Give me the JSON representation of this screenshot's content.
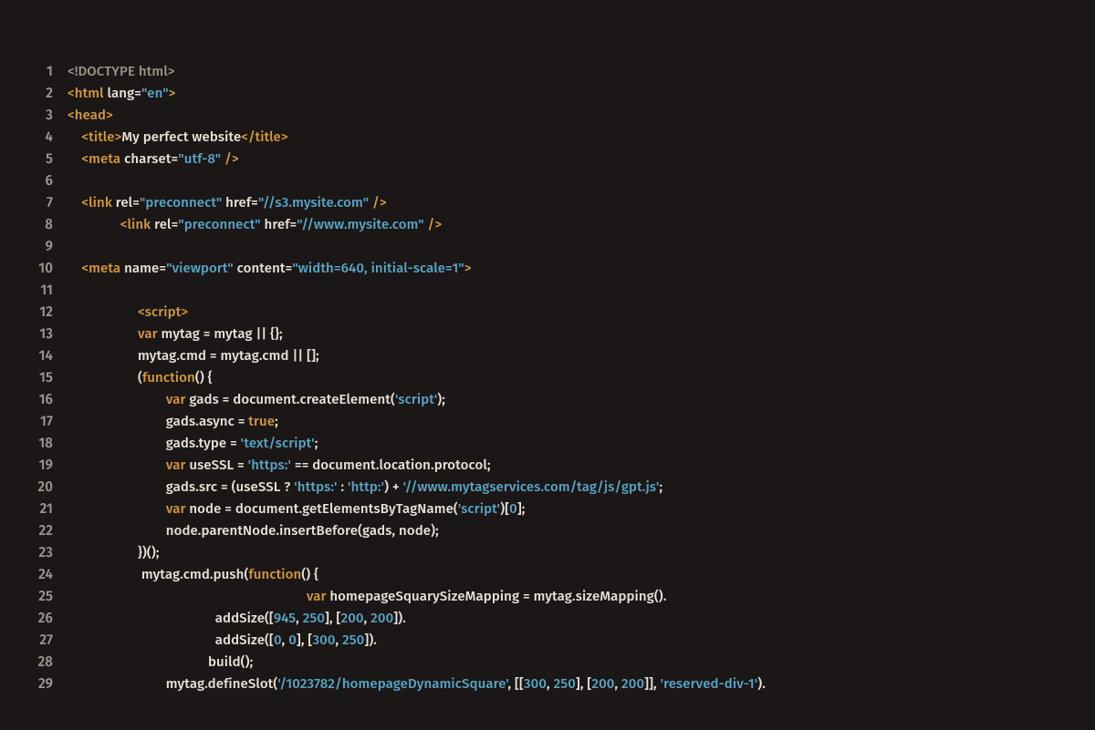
{
  "editor": {
    "theme": {
      "background": "#1b1717",
      "foreground": "#e9e4d8",
      "gutter": "#9a958b",
      "tag": "#d49a3a",
      "string": "#58a6c7",
      "dim": "#9a958b"
    },
    "first_line_number": 1,
    "lines": [
      {
        "n": 1,
        "tokens": [
          {
            "t": "<!DOCTYPE html>",
            "c": "dim"
          }
        ]
      },
      {
        "n": 2,
        "tokens": [
          {
            "t": "<html",
            "c": "tag"
          },
          {
            "t": " lang=",
            "c": "text"
          },
          {
            "t": "\"en\"",
            "c": "str"
          },
          {
            "t": ">",
            "c": "tag"
          }
        ]
      },
      {
        "n": 3,
        "tokens": [
          {
            "t": "<head>",
            "c": "tag"
          }
        ]
      },
      {
        "n": 4,
        "tokens": [
          {
            "t": "    ",
            "c": "text"
          },
          {
            "t": "<title>",
            "c": "tag"
          },
          {
            "t": "My perfect website",
            "c": "text"
          },
          {
            "t": "</title>",
            "c": "tag"
          }
        ]
      },
      {
        "n": 5,
        "tokens": [
          {
            "t": "    ",
            "c": "text"
          },
          {
            "t": "<meta",
            "c": "tag"
          },
          {
            "t": " charset=",
            "c": "text"
          },
          {
            "t": "\"utf-8\"",
            "c": "str"
          },
          {
            "t": " />",
            "c": "tag"
          }
        ]
      },
      {
        "n": 6,
        "tokens": []
      },
      {
        "n": 7,
        "tokens": [
          {
            "t": "    ",
            "c": "text"
          },
          {
            "t": "<link",
            "c": "tag"
          },
          {
            "t": " rel=",
            "c": "text"
          },
          {
            "t": "\"preconnect\"",
            "c": "str"
          },
          {
            "t": " href=",
            "c": "text"
          },
          {
            "t": "\"//s3.mysite.com\"",
            "c": "str"
          },
          {
            "t": " />",
            "c": "tag"
          }
        ]
      },
      {
        "n": 8,
        "tokens": [
          {
            "t": "               ",
            "c": "text"
          },
          {
            "t": "<link",
            "c": "tag"
          },
          {
            "t": " rel=",
            "c": "text"
          },
          {
            "t": "\"preconnect\"",
            "c": "str"
          },
          {
            "t": " href=",
            "c": "text"
          },
          {
            "t": "\"//www.mysite.com\"",
            "c": "str"
          },
          {
            "t": " />",
            "c": "tag"
          }
        ]
      },
      {
        "n": 9,
        "tokens": []
      },
      {
        "n": 10,
        "tokens": [
          {
            "t": "    ",
            "c": "text"
          },
          {
            "t": "<meta",
            "c": "tag"
          },
          {
            "t": " name=",
            "c": "text"
          },
          {
            "t": "\"viewport\"",
            "c": "str"
          },
          {
            "t": " content=",
            "c": "text"
          },
          {
            "t": "\"width=640, initial-scale=1\"",
            "c": "str"
          },
          {
            "t": ">",
            "c": "tag"
          }
        ]
      },
      {
        "n": 11,
        "tokens": []
      },
      {
        "n": 12,
        "tokens": [
          {
            "t": "                    ",
            "c": "text"
          },
          {
            "t": "<script>",
            "c": "tag"
          }
        ]
      },
      {
        "n": 13,
        "tokens": [
          {
            "t": "                    ",
            "c": "text"
          },
          {
            "t": "var",
            "c": "tag"
          },
          {
            "t": " mytag = mytag || {};",
            "c": "text"
          }
        ]
      },
      {
        "n": 14,
        "tokens": [
          {
            "t": "                    mytag.cmd = mytag.cmd || [];",
            "c": "text"
          }
        ]
      },
      {
        "n": 15,
        "tokens": [
          {
            "t": "                    (",
            "c": "text"
          },
          {
            "t": "function",
            "c": "tag"
          },
          {
            "t": "() {",
            "c": "text"
          }
        ]
      },
      {
        "n": 16,
        "tokens": [
          {
            "t": "                            ",
            "c": "text"
          },
          {
            "t": "var",
            "c": "tag"
          },
          {
            "t": " gads = document.createElement(",
            "c": "text"
          },
          {
            "t": "'script'",
            "c": "str"
          },
          {
            "t": ");",
            "c": "text"
          }
        ]
      },
      {
        "n": 17,
        "tokens": [
          {
            "t": "                            gads.async = ",
            "c": "text"
          },
          {
            "t": "true",
            "c": "tag"
          },
          {
            "t": ";",
            "c": "text"
          }
        ]
      },
      {
        "n": 18,
        "tokens": [
          {
            "t": "                            gads.type = ",
            "c": "text"
          },
          {
            "t": "'text/script'",
            "c": "str"
          },
          {
            "t": ";",
            "c": "text"
          }
        ]
      },
      {
        "n": 19,
        "tokens": [
          {
            "t": "                            ",
            "c": "text"
          },
          {
            "t": "var",
            "c": "tag"
          },
          {
            "t": " useSSL = ",
            "c": "text"
          },
          {
            "t": "'https:'",
            "c": "str"
          },
          {
            "t": " == document.location.protocol;",
            "c": "text"
          }
        ]
      },
      {
        "n": 20,
        "tokens": [
          {
            "t": "                            gads.src = (useSSL ? ",
            "c": "text"
          },
          {
            "t": "'https:'",
            "c": "str"
          },
          {
            "t": " : ",
            "c": "text"
          },
          {
            "t": "'http:'",
            "c": "str"
          },
          {
            "t": ") + ",
            "c": "text"
          },
          {
            "t": "'//www.mytagservices.com/tag/js/gpt.js'",
            "c": "str"
          },
          {
            "t": ";",
            "c": "text"
          }
        ]
      },
      {
        "n": 21,
        "tokens": [
          {
            "t": "                            ",
            "c": "text"
          },
          {
            "t": "var",
            "c": "tag"
          },
          {
            "t": " node = document.getElementsByTagName(",
            "c": "text"
          },
          {
            "t": "'script'",
            "c": "str"
          },
          {
            "t": ")[",
            "c": "text"
          },
          {
            "t": "0",
            "c": "num"
          },
          {
            "t": "];",
            "c": "text"
          }
        ]
      },
      {
        "n": 22,
        "tokens": [
          {
            "t": "                            node.parentNode.insertBefore(gads, node);",
            "c": "text"
          }
        ]
      },
      {
        "n": 23,
        "tokens": [
          {
            "t": "                    })();",
            "c": "text"
          }
        ]
      },
      {
        "n": 24,
        "tokens": [
          {
            "t": "                     mytag.cmd.push(",
            "c": "text"
          },
          {
            "t": "function",
            "c": "tag"
          },
          {
            "t": "() {",
            "c": "text"
          }
        ]
      },
      {
        "n": 25,
        "tokens": [
          {
            "t": "                                                                    ",
            "c": "text"
          },
          {
            "t": "var",
            "c": "tag"
          },
          {
            "t": " homepageSquarySizeMapping = mytag.sizeMapping().",
            "c": "text"
          }
        ]
      },
      {
        "n": 26,
        "tokens": [
          {
            "t": "                                          addSize([",
            "c": "text"
          },
          {
            "t": "945",
            "c": "num"
          },
          {
            "t": ", ",
            "c": "text"
          },
          {
            "t": "250",
            "c": "num"
          },
          {
            "t": "], [",
            "c": "text"
          },
          {
            "t": "200",
            "c": "num"
          },
          {
            "t": ", ",
            "c": "text"
          },
          {
            "t": "200",
            "c": "num"
          },
          {
            "t": "]).",
            "c": "text"
          }
        ]
      },
      {
        "n": 27,
        "tokens": [
          {
            "t": "                                          addSize([",
            "c": "text"
          },
          {
            "t": "0",
            "c": "num"
          },
          {
            "t": ", ",
            "c": "text"
          },
          {
            "t": "0",
            "c": "num"
          },
          {
            "t": "], [",
            "c": "text"
          },
          {
            "t": "300",
            "c": "num"
          },
          {
            "t": ", ",
            "c": "text"
          },
          {
            "t": "250",
            "c": "num"
          },
          {
            "t": "]).",
            "c": "text"
          }
        ]
      },
      {
        "n": 28,
        "tokens": [
          {
            "t": "                                        build();",
            "c": "text"
          }
        ]
      },
      {
        "n": 29,
        "tokens": [
          {
            "t": "                            mytag.defineSlot(",
            "c": "text"
          },
          {
            "t": "'/1023782/homepageDynamicSquare'",
            "c": "str"
          },
          {
            "t": ", [[",
            "c": "text"
          },
          {
            "t": "300",
            "c": "num"
          },
          {
            "t": ", ",
            "c": "text"
          },
          {
            "t": "250",
            "c": "num"
          },
          {
            "t": "], [",
            "c": "text"
          },
          {
            "t": "200",
            "c": "num"
          },
          {
            "t": ", ",
            "c": "text"
          },
          {
            "t": "200",
            "c": "num"
          },
          {
            "t": "]], ",
            "c": "text"
          },
          {
            "t": "'reserved-div-1'",
            "c": "str"
          },
          {
            "t": ").",
            "c": "text"
          }
        ]
      }
    ]
  }
}
